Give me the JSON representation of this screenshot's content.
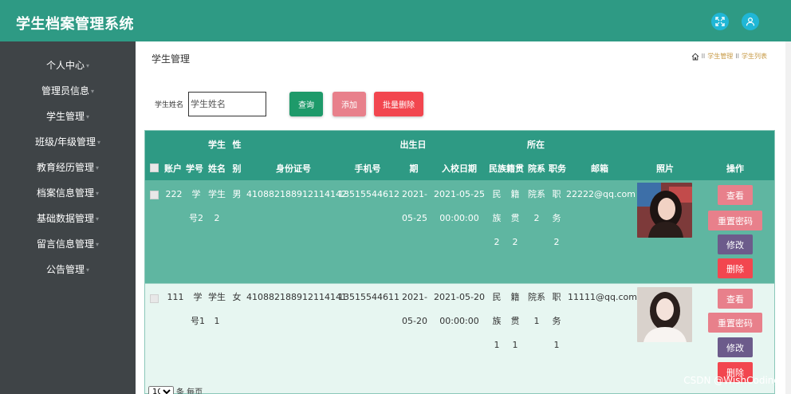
{
  "app": {
    "title": "学生档案管理系统"
  },
  "header": {
    "fullscreen_icon": "fullscreen-icon",
    "user_icon": "user-icon"
  },
  "sidebar": {
    "items": [
      {
        "label": "个人中心"
      },
      {
        "label": "管理员信息"
      },
      {
        "label": "学生管理"
      },
      {
        "label": "班级/年级管理"
      },
      {
        "label": "教育经历管理"
      },
      {
        "label": "档案信息管理"
      },
      {
        "label": "基础数据管理"
      },
      {
        "label": "留言信息管理"
      },
      {
        "label": "公告管理"
      }
    ],
    "caret": "▾"
  },
  "page": {
    "title": "学生管理",
    "breadcrumb": {
      "sep": "II",
      "items": [
        "学生管理",
        "学生列表"
      ]
    }
  },
  "search": {
    "label": "学生姓名",
    "placeholder": "学生姓名",
    "query_label": "查询",
    "add_label": "添加",
    "batch_delete_label": "批量删除"
  },
  "table": {
    "header_top": {
      "student_pre": "学生",
      "sex_pre": "性",
      "birth_pre": "出生日",
      "location_pre": "所在"
    },
    "header_bottom": {
      "account": "账户",
      "student_no": "学号",
      "name": "姓名",
      "sex": "别",
      "id_card": "身份证号",
      "phone": "手机号",
      "birth": "期",
      "enroll_date": "入校日期",
      "nation": "民族",
      "native_place": "籍贯",
      "department": "院系",
      "position": "职务",
      "email": "邮箱",
      "photo": "照片",
      "actions": "操作"
    },
    "rows": [
      {
        "account": "222",
        "student_no": [
          "学",
          "号2"
        ],
        "name": [
          "学生",
          "2"
        ],
        "sex": "男",
        "id_card": "410882188912114142",
        "phone": "13515544612",
        "birth": [
          "2021-",
          "05-25"
        ],
        "enroll": [
          "2021-05-25",
          "00:00:00"
        ],
        "nation": [
          "民",
          "族",
          "2"
        ],
        "native": [
          "籍",
          "贯",
          "2"
        ],
        "department": [
          "院系",
          "2"
        ],
        "position": [
          "职",
          "务",
          "2"
        ],
        "email": "22222@qq.com"
      },
      {
        "account": "111",
        "student_no": [
          "学",
          "号1"
        ],
        "name": [
          "学生",
          "1"
        ],
        "sex": "女",
        "id_card": "410882188912114141",
        "phone": "13515544611",
        "birth": [
          "2021-",
          "05-20"
        ],
        "enroll": [
          "2021-05-20",
          "00:00:00"
        ],
        "nation": [
          "民",
          "族",
          "1"
        ],
        "native": [
          "籍",
          "贯",
          "1"
        ],
        "department": [
          "院系",
          "1"
        ],
        "position": [
          "职",
          "务",
          "1"
        ],
        "email": "11111@qq.com"
      }
    ],
    "actions": {
      "view": "查看",
      "reset": "重置密码",
      "edit": "修改",
      "delete": "删除"
    }
  },
  "pager": {
    "page_size": "10",
    "per_page_label": "条 每页"
  },
  "watermark": "CSDN @WishCoding",
  "colors": {
    "primary": "#2e9a84",
    "sidebar": "#3f4447",
    "row_selected": "#5fb6a1",
    "row_alt": "#e7f6f1",
    "danger": "#f2464f",
    "pink": "#e8808b",
    "purple": "#6c5b8b",
    "accent": "#20b7d6"
  }
}
